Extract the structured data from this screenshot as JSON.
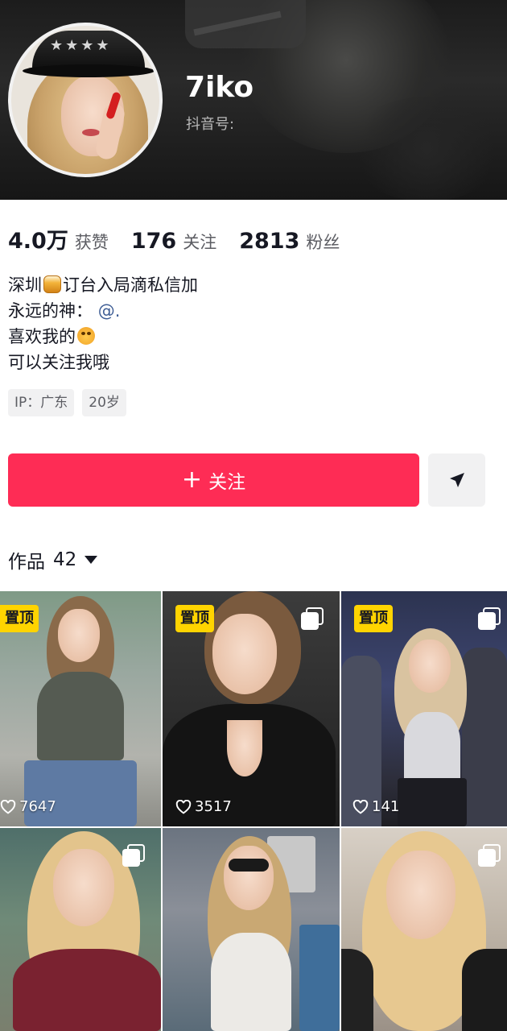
{
  "profile": {
    "username": "7iko",
    "douyin_id_label": "抖音号:"
  },
  "stats": [
    {
      "value": "4.0万",
      "label": "获赞"
    },
    {
      "value": "176",
      "label": "关注"
    },
    {
      "value": "2813",
      "label": "粉丝"
    }
  ],
  "bio": {
    "line1_a": "深圳",
    "line1_b": "订台入局滴私信加",
    "line2_a": "永远的神：",
    "line2_mention": "@.",
    "line3": "喜欢我的",
    "line4": "可以关注我哦"
  },
  "tags": [
    "IP：广东",
    "20岁"
  ],
  "actions": {
    "follow_label": "关注",
    "plus_symbol": "+"
  },
  "works": {
    "label": "作品",
    "count": "42"
  },
  "posts": [
    {
      "pinned": true,
      "pin_label": "置顶",
      "multi": false,
      "likes": "7647"
    },
    {
      "pinned": true,
      "pin_label": "置顶",
      "multi": true,
      "likes": "3517"
    },
    {
      "pinned": true,
      "pin_label": "置顶",
      "multi": true,
      "likes": "141"
    },
    {
      "pinned": false,
      "multi": true,
      "likes": ""
    },
    {
      "pinned": false,
      "multi": false,
      "likes": ""
    },
    {
      "pinned": false,
      "multi": true,
      "likes": ""
    }
  ],
  "colors": {
    "accent": "#fe2c55",
    "pin_badge": "#ffd400",
    "mention": "#3f5e95"
  }
}
